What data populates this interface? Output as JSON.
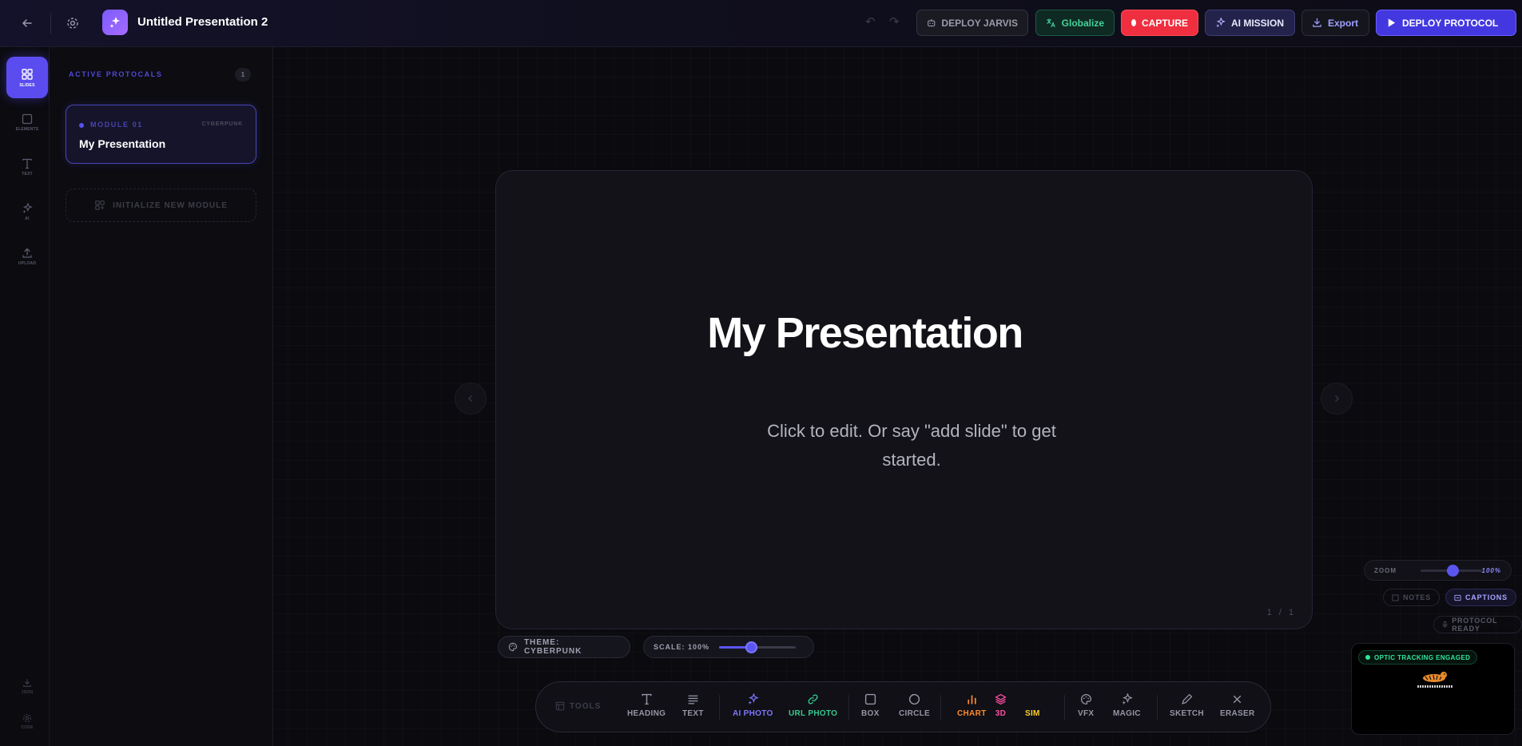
{
  "header": {
    "title": "Untitled Presentation 2",
    "buttons": {
      "deploy_jarvis": "DEPLOY JARVIS",
      "globalize": "Globalize",
      "capture": "CAPTURE",
      "ai_mission": "AI MISSION",
      "export": "Export",
      "deploy_protocol": "DEPLOY PROTOCOL"
    }
  },
  "rail": {
    "items": [
      {
        "label": "SLIDES",
        "icon": "grid-icon"
      },
      {
        "label": "ELEMENTS",
        "icon": "square-icon"
      },
      {
        "label": "TEXT",
        "icon": "text-icon"
      },
      {
        "label": "AI",
        "icon": "sparkle-icon"
      },
      {
        "label": "UPLOAD",
        "icon": "upload-icon"
      }
    ],
    "bottom": [
      {
        "label": "JSON",
        "icon": "download-icon"
      },
      {
        "label": "CODE",
        "icon": "gear-icon"
      }
    ]
  },
  "sidebar": {
    "heading": "ACTIVE PROTOCALS",
    "count": "1",
    "module": {
      "number": "MODULE 01",
      "theme": "CYBERPUNK",
      "title": "My Presentation"
    },
    "init_label": "INITIALIZE NEW MODULE"
  },
  "slide": {
    "title": "My Presentation",
    "subtitle": "Click to edit. Or say \"add slide\" to get started.",
    "page": "1 / 1"
  },
  "theme_pill": "THEME: CYBERPUNK",
  "scale": {
    "label": "SCALE: 100%",
    "value": 1.0
  },
  "toolbar": {
    "label": "TOOLS",
    "tools": {
      "heading": "HEADING",
      "text": "TEXT",
      "ai_photo": "AI PHOTO",
      "url_photo": "URL PHOTO",
      "box": "BOX",
      "circle": "CIRCLE",
      "chart": "CHART",
      "three_d": "3D",
      "sim": "SIM",
      "vfx": "VFX",
      "magic": "MAGIC",
      "sketch": "SKETCH",
      "eraser": "ERASER"
    }
  },
  "zoom": {
    "label": "ZOOM",
    "value": "100%"
  },
  "notes_label": "NOTES",
  "captions_label": "CAPTIONS",
  "protocol_ready": "PROTOCOL READY",
  "camera": {
    "status": "OPTIC TRACKING ENGAGED"
  },
  "colors": {
    "accent": "#5b4cf0",
    "capture": "#ef2f3f",
    "globalize": "#45d19c",
    "chart": "#ff8a2a",
    "three_d": "#ff4fa3",
    "sim": "#ffd02a"
  }
}
